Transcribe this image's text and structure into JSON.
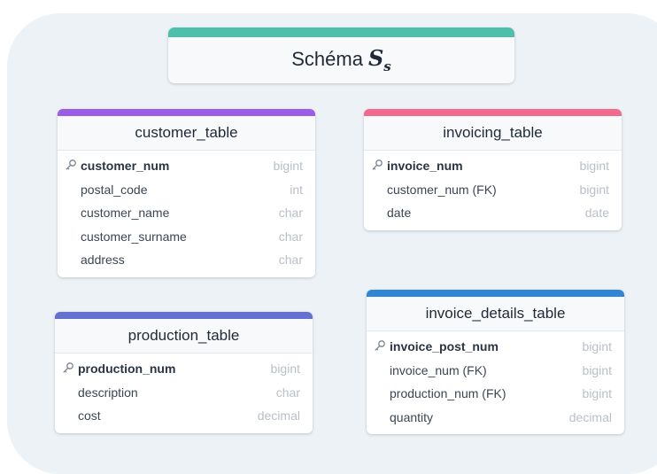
{
  "title": {
    "text": "Schéma",
    "symbol": "S",
    "subscript": "s"
  },
  "tables": [
    {
      "name": "customer_table",
      "color": "#9b5de5",
      "columns": [
        {
          "name": "customer_num",
          "type": "bigint",
          "pk": true
        },
        {
          "name": "postal_code",
          "type": "int",
          "pk": false
        },
        {
          "name": "customer_name",
          "type": "char",
          "pk": false
        },
        {
          "name": "customer_surname",
          "type": "char",
          "pk": false
        },
        {
          "name": "address",
          "type": "char",
          "pk": false
        }
      ]
    },
    {
      "name": "invoicing_table",
      "color": "#f06b8e",
      "columns": [
        {
          "name": "invoice_num",
          "type": "bigint",
          "pk": true
        },
        {
          "name": "customer_num (FK)",
          "type": "bigint",
          "pk": false
        },
        {
          "name": "date",
          "type": "date",
          "pk": false
        }
      ]
    },
    {
      "name": "production_table",
      "color": "#6570cf",
      "columns": [
        {
          "name": "production_num",
          "type": "bigint",
          "pk": true
        },
        {
          "name": "description",
          "type": "char",
          "pk": false
        },
        {
          "name": "cost",
          "type": "decimal",
          "pk": false
        }
      ]
    },
    {
      "name": "invoice_details_table",
      "color": "#2f86d6",
      "columns": [
        {
          "name": "invoice_post_num",
          "type": "bigint",
          "pk": true
        },
        {
          "name": "invoice_num (FK)",
          "type": "bigint",
          "pk": false
        },
        {
          "name": "production_num (FK)",
          "type": "bigint",
          "pk": false
        },
        {
          "name": "quantity",
          "type": "decimal",
          "pk": false
        }
      ]
    }
  ]
}
